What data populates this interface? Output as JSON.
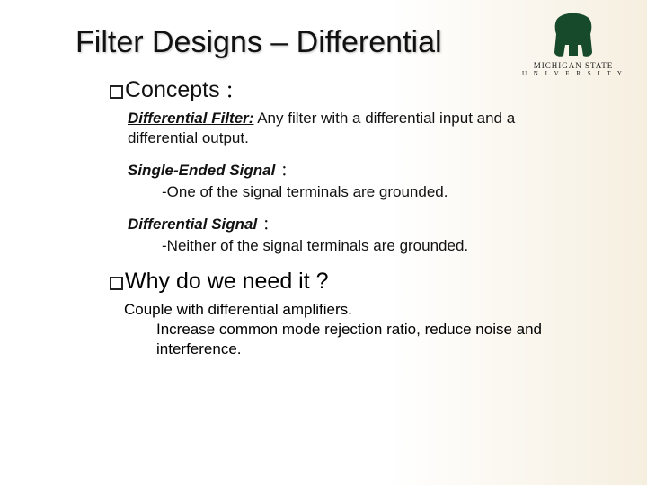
{
  "logo": {
    "alt": "spartan-helmet",
    "line1": "MICHIGAN STATE",
    "line2": "U N I V E R S I T Y"
  },
  "title": "Filter Designs – Differential",
  "concepts": {
    "label": "Concepts",
    "colon": "：",
    "diff_filter_term": "Differential Filter:",
    "diff_filter_body": " Any filter with a differential input and a differential output.",
    "single_term": "Single-Ended Signal",
    "single_colon": "：",
    "single_body": "-One of the signal terminals are grounded.",
    "diff_sig_term": "Differential Signal",
    "diff_sig_colon": "：",
    "diff_sig_body": "-Neither of the signal terminals are grounded."
  },
  "why": {
    "label": "Why do we need it ?",
    "line1": "Couple with differential amplifiers.",
    "line2": "Increase common mode rejection ratio, reduce noise and interference."
  }
}
